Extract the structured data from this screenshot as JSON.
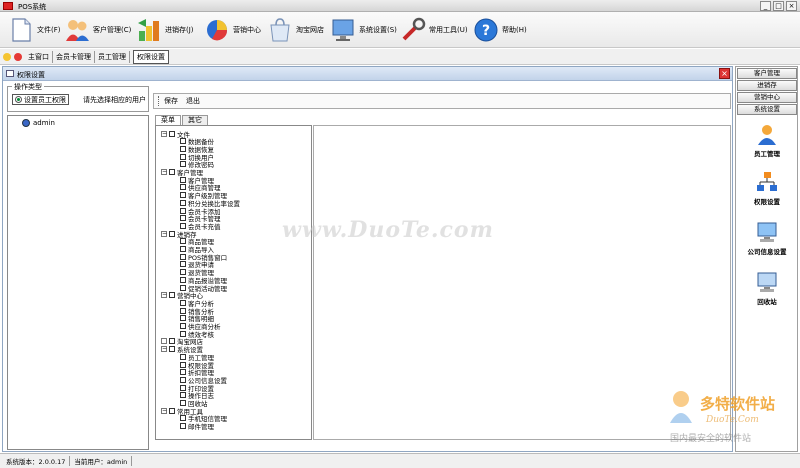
{
  "window": {
    "title": "POS系统",
    "icon": "app-icon",
    "controls": [
      "minimize-icon",
      "maximize-icon",
      "close-icon"
    ]
  },
  "toolbar": {
    "items": [
      {
        "label": "文件(F)",
        "icon": "document-icon"
      },
      {
        "label": "客户管理(C)",
        "icon": "users-icon"
      },
      {
        "label": "进销存(J)",
        "icon": "stock-icon"
      },
      {
        "label": "营销中心",
        "icon": "pie-chart-icon"
      },
      {
        "label": "淘宝网店",
        "icon": "shopping-bag-icon"
      },
      {
        "label": "系统设置(S)",
        "icon": "monitor-icon"
      },
      {
        "label": "常用工具(U)",
        "icon": "tools-icon"
      },
      {
        "label": "帮助(H)",
        "icon": "help-icon"
      }
    ]
  },
  "tabs": {
    "items": [
      "主窗口",
      "会员卡管理",
      "员工管理",
      "权限设置"
    ],
    "active": "权限设置"
  },
  "panel": {
    "title": "权限设置",
    "group_legend": "操作类型",
    "radio_label": "设置员工权限",
    "hint": "请先选择相应的用户",
    "users": [
      "admin"
    ],
    "actions": [
      "保存",
      "退出"
    ],
    "inner_tabs": [
      "菜单",
      "其它"
    ],
    "inner_tab_active": "菜单"
  },
  "tree": [
    {
      "label": "文件",
      "children": [
        "数据备份",
        "数据恢复",
        "切换用户",
        "修改密码"
      ]
    },
    {
      "label": "客户管理",
      "children": [
        "客户管理",
        "供应商管理",
        "客户级别管理",
        "积分兑换比率设置",
        "会员卡添加",
        "会员卡管理",
        "会员卡充值"
      ]
    },
    {
      "label": "进销存",
      "children": [
        "商品管理",
        "商品导入",
        "POS销售窗口",
        "退货申请",
        "退货管理",
        "商品报溢管理",
        "促销活动管理"
      ]
    },
    {
      "label": "营销中心",
      "children": [
        "客户分析",
        "销售分析",
        "销售明细",
        "供应商分析",
        "绩效考核"
      ]
    },
    {
      "label": "淘宝网店",
      "children": []
    },
    {
      "label": "系统设置",
      "children": [
        "员工管理",
        "权限设置",
        "折扣管理",
        "公司信息设置",
        "打印设置",
        "操作日志",
        "回收站"
      ]
    },
    {
      "label": "常用工具",
      "children": [
        "手机短信管理",
        "邮件管理"
      ]
    }
  ],
  "sidebar": {
    "tabs": [
      "客户管理",
      "进销存",
      "营销中心",
      "系统设置"
    ],
    "items": [
      {
        "label": "员工管理",
        "icon": "person-icon"
      },
      {
        "label": "权限设置",
        "icon": "org-chart-icon"
      },
      {
        "label": "公司信息设置",
        "icon": "computer-icon"
      },
      {
        "label": "回收站",
        "icon": "recycle-bin-icon"
      }
    ]
  },
  "status": {
    "version": "系统版本：2.0.0.17",
    "user": "当前用户：admin"
  },
  "watermarks": {
    "center": "www.DuoTe.com",
    "brand": "多特软件站",
    "url": "DuoTe.Com",
    "slogan": "国内最安全的软件站"
  },
  "colors": {
    "panel_border": "#8fa6c2",
    "panel_title": "#c2d3ea",
    "close_red": "#dd3333"
  }
}
